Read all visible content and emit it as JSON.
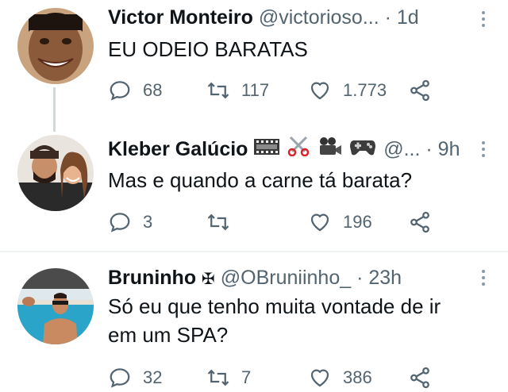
{
  "tweets": [
    {
      "name": "Victor Monteiro",
      "handle": "@victorioso...",
      "dot": "·",
      "time": "1d",
      "text": "EU ODEIO BARATAS",
      "replies": "68",
      "retweets": "117",
      "likes": "1.773"
    },
    {
      "name": "Kleber Galúcio",
      "emojis": [
        "film-frames-icon",
        "scissors-icon",
        "movie-camera-icon",
        "game-controller-icon"
      ],
      "handle": "@...",
      "dot": "·",
      "time": "9h",
      "text": "Mas e quando a carne tá barata?",
      "replies": "3",
      "retweets": "",
      "likes": "196"
    },
    {
      "name": "Bruninho",
      "badge": "✠",
      "handle": "@OBruniinho_",
      "dot": "·",
      "time": "23h",
      "text_line1": "Só eu que tenho muita vontade de ir",
      "text_line2": "em um SPA?",
      "replies": "32",
      "retweets": "7",
      "likes": "386"
    }
  ],
  "colors": {
    "text": "#0f1419",
    "secondary": "#536471",
    "divider": "#eff3f4",
    "thread_line": "#cfd9de"
  }
}
